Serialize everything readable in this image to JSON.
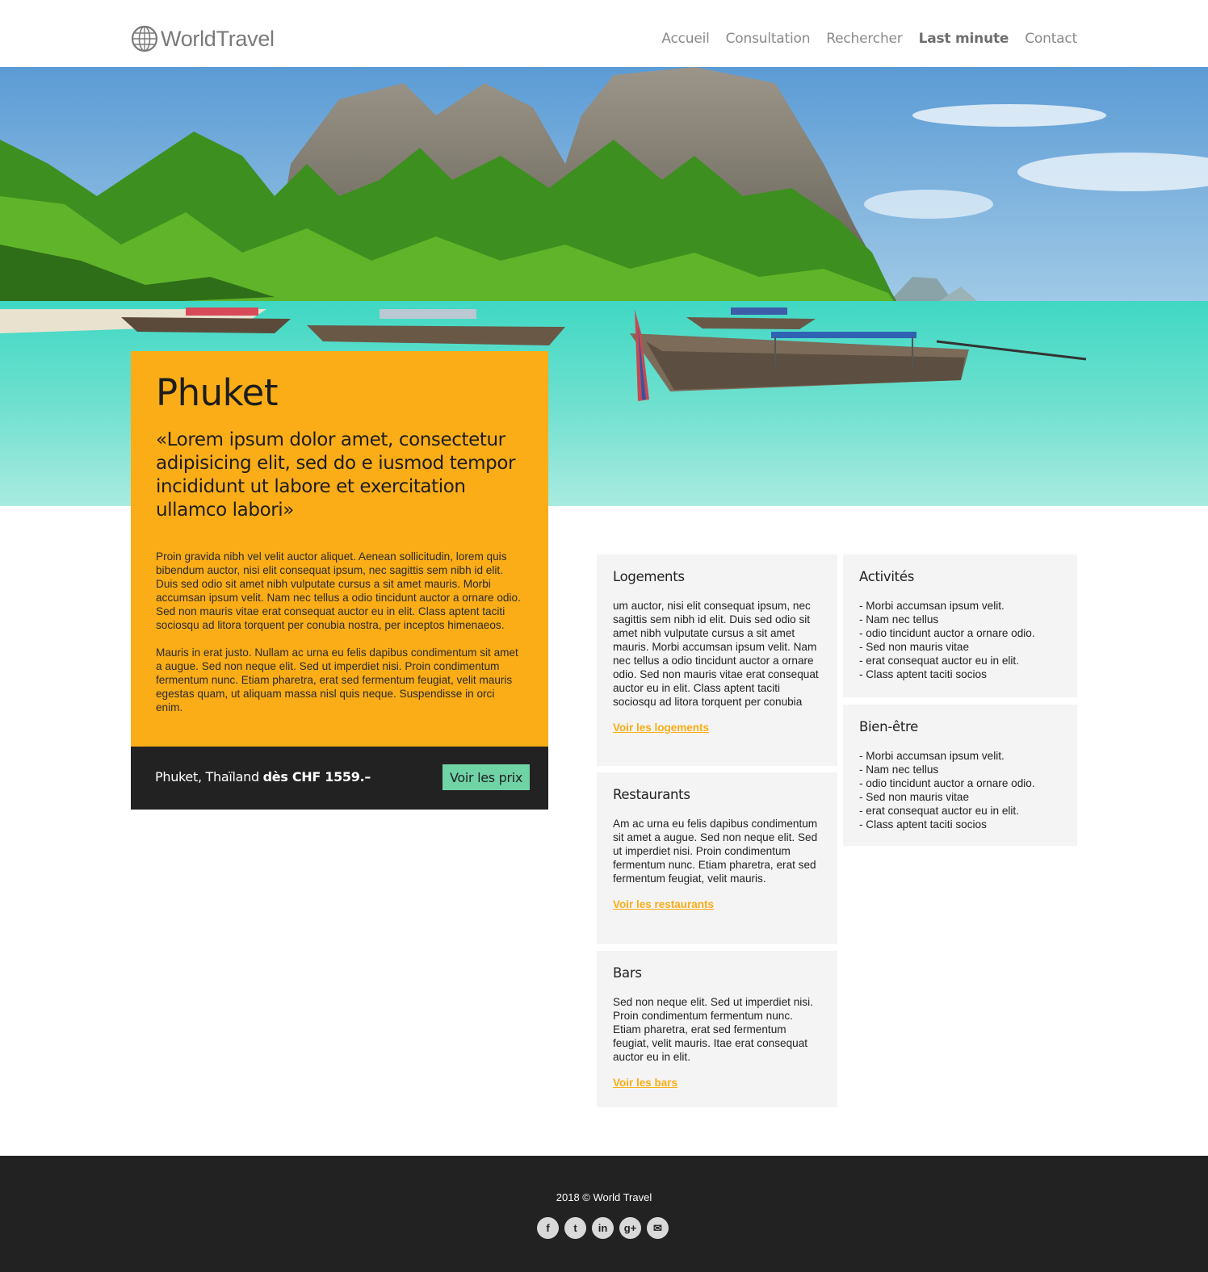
{
  "header": {
    "logo_text": "WorldTravel",
    "nav": [
      {
        "label": "Accueil"
      },
      {
        "label": "Consultation"
      },
      {
        "label": "Rechercher"
      },
      {
        "label": "Last minute"
      },
      {
        "label": "Contact"
      }
    ]
  },
  "destination": {
    "title": "Phuket",
    "quote": "«Lorem ipsum dolor amet, consectetur adipisicing elit, sed do e iusmod tempor incididunt ut labore et exercitation ullamco labori»",
    "paragraph_1": "Proin gravida nibh vel velit auctor aliquet. Aenean sollicitudin, lorem quis bibendum auctor, nisi elit consequat ipsum, nec sagittis sem nibh id elit. Duis sed odio sit amet nibh vulputate cursus a sit amet mauris. Morbi accumsan ipsum velit. Nam nec tellus a odio tincidunt auctor a ornare odio. Sed non  mauris vitae erat consequat auctor eu in elit. Class aptent taciti sociosqu ad litora torquent per conubia nostra, per inceptos himenaeos.",
    "paragraph_2": "Mauris in erat justo. Nullam ac urna eu felis dapibus condimentum sit amet a augue. Sed non neque elit. Sed ut imperdiet nisi. Proin condimentum fermentum nunc. Etiam pharetra, erat sed fermentum feugiat, velit mauris egestas quam, ut aliquam massa nisl quis neque. Suspendisse in orci enim.",
    "location": "Phuket, Thaïland",
    "price": "dès CHF 1559.–",
    "price_button": "Voir les prix"
  },
  "boxes": {
    "logements": {
      "title": "Logements",
      "text": "um auctor, nisi elit consequat ipsum, nec sagittis sem nibh id elit. Duis sed odio sit amet nibh vulputate cursus a sit amet mauris. Morbi accumsan ipsum velit. Nam nec tellus a odio tincidunt auctor a ornare odio. Sed non  mauris vitae erat consequat auctor eu in elit. Class aptent taciti sociosqu ad litora torquent per conubia",
      "link": "Voir les logements"
    },
    "restaurants": {
      "title": "Restaurants",
      "text": "Am ac urna eu felis dapibus condimentum sit amet a augue. Sed non neque elit. Sed ut imperdiet nisi. Proin condimentum fermentum nunc. Etiam pharetra, erat sed fermentum feugiat, velit mauris.",
      "link": "Voir les restaurants"
    },
    "bars": {
      "title": "Bars",
      "text": "Sed non neque elit. Sed ut imperdiet nisi. Proin condimentum fermentum nunc. Etiam pharetra, erat sed fermentum feugiat, velit mauris. Itae erat consequat auctor eu in elit.",
      "link": "Voir les bars"
    },
    "activites": {
      "title": "Activités",
      "items": [
        "- Morbi accumsan ipsum velit.",
        "- Nam nec tellus",
        "- odio tincidunt auctor a ornare odio.",
        "- Sed non  mauris vitae",
        "- erat consequat auctor eu in elit.",
        "- Class aptent taciti socios"
      ]
    },
    "bienetre": {
      "title": "Bien-être",
      "items": [
        "- Morbi accumsan ipsum velit.",
        "- Nam nec tellus",
        "- odio tincidunt auctor a ornare odio.",
        "- Sed non  mauris vitae",
        "- erat consequat auctor eu in elit.",
        "- Class aptent taciti socios"
      ]
    }
  },
  "footer": {
    "copyright": "2018 © World Travel",
    "social_icons": [
      "facebook-icon",
      "twitter-icon",
      "linkedin-icon",
      "google-plus-icon",
      "mail-icon"
    ],
    "social_glyphs": [
      "f",
      "t",
      "in",
      "g+",
      "✉"
    ]
  },
  "colors": {
    "accent": "#fbad17",
    "dark": "#222222",
    "button": "#6fd3a6",
    "box_bg": "#f4f4f4"
  }
}
